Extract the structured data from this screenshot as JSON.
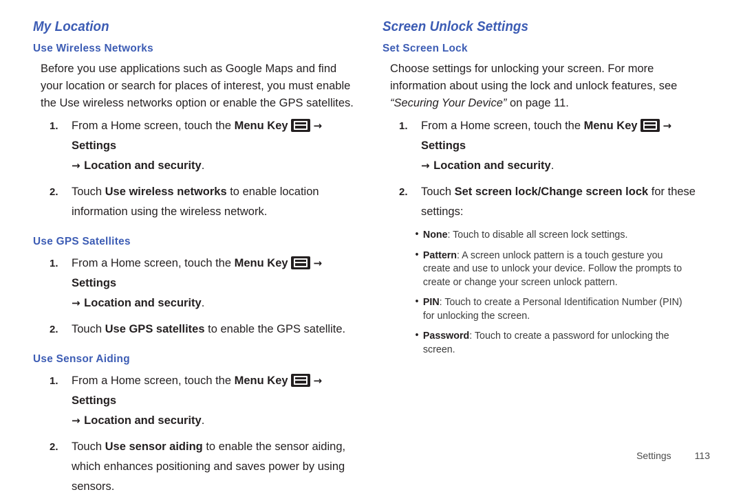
{
  "page": {
    "footer_label": "Settings",
    "footer_page_number": "113",
    "heading_color": "#3c5cb4",
    "body_color": "#231f20",
    "background": "#ffffff"
  },
  "icons": {
    "menu_key": "menu-key-icon",
    "arrow": "→",
    "bullet": "•"
  },
  "left_column": {
    "title": "My Location",
    "sections": [
      {
        "heading": "Use Wireless Networks",
        "paragraph": "Before you use applications such as Google Maps and find your location or search for places of interest, you must enable the Use wireless networks option or enable the GPS satellites.",
        "steps": [
          {
            "number": "1.",
            "lead": "From a Home screen, touch the ",
            "bold1": "Menu Key",
            "after_icon_arrow": "→",
            "bold2": "Settings",
            "continuation_arrow": "→",
            "continuation_bold": "Location and security",
            "continuation_tail": "."
          },
          {
            "number": "2.",
            "text_before": "Touch ",
            "bold": "Use wireless networks",
            "text_after": " to enable location information using the wireless network."
          }
        ]
      },
      {
        "heading": "Use GPS Satellites",
        "steps": [
          {
            "number": "1.",
            "lead": "From a Home screen, touch the ",
            "bold1": "Menu Key",
            "after_icon_arrow": "→",
            "bold2": "Settings",
            "continuation_arrow": "→",
            "continuation_bold": "Location and security",
            "continuation_tail": "."
          },
          {
            "number": "2.",
            "text_before": "Touch ",
            "bold": "Use GPS satellites",
            "text_after": " to enable the GPS satellite."
          }
        ]
      },
      {
        "heading": "Use Sensor Aiding",
        "steps": [
          {
            "number": "1.",
            "lead": "From a Home screen, touch the ",
            "bold1": "Menu Key",
            "after_icon_arrow": "→",
            "bold2": "Settings",
            "continuation_arrow": "→",
            "continuation_bold": "Location and security",
            "continuation_tail": "."
          },
          {
            "number": "2.",
            "text_before": "Touch ",
            "bold": "Use sensor aiding",
            "text_after": " to enable the sensor aiding, which enhances positioning and saves power by using sensors."
          }
        ]
      }
    ]
  },
  "right_column": {
    "title": "Screen Unlock Settings",
    "section": {
      "heading": "Set Screen Lock",
      "paragraph_part1": "Choose settings for unlocking your screen. For more information about using the lock and unlock features, see ",
      "paragraph_italic": "“Securing Your Device”",
      "paragraph_part2": " on page 11.",
      "steps": [
        {
          "number": "1.",
          "lead": "From a Home screen, touch the ",
          "bold1": "Menu Key",
          "after_icon_arrow": "→",
          "bold2": "Settings",
          "continuation_arrow": "→",
          "continuation_bold": "Location and security",
          "continuation_tail": "."
        },
        {
          "number": "2.",
          "text_before": "Touch ",
          "bold": "Set screen lock/Change screen lock",
          "text_after": " for these settings:"
        }
      ],
      "bullets": [
        {
          "term": "None",
          "description": ": Touch to disable all screen lock settings."
        },
        {
          "term": "Pattern",
          "description": ": A screen unlock pattern is a touch gesture you create and use to unlock your device. Follow the prompts to create or change your screen unlock pattern."
        },
        {
          "term": "PIN",
          "description": ": Touch to create a Personal Identification Number (PIN) for unlocking the screen."
        },
        {
          "term": "Password",
          "description": ": Touch to create a password for unlocking the screen."
        }
      ]
    }
  }
}
